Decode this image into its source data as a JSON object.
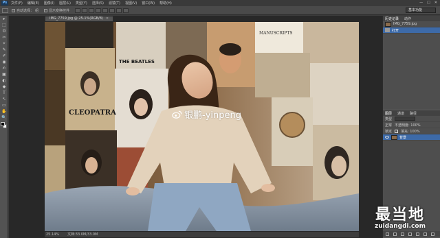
{
  "menubar": {
    "logo": "Ps",
    "items": [
      "文件(F)",
      "编辑(E)",
      "图像(I)",
      "图层(L)",
      "类型(Y)",
      "选择(S)",
      "滤镜(T)",
      "视图(V)",
      "窗口(W)",
      "帮助(H)"
    ],
    "window_controls": [
      "—",
      "□",
      "✕"
    ]
  },
  "optionsbar": {
    "auto_select_label": "自动选择：",
    "auto_select_value": "组",
    "show_transform_label": "显示变换控件",
    "workspace": "基本功能"
  },
  "toolbox": {
    "tools": [
      "▸",
      "⬚",
      "ʘ",
      "✂",
      "⌖",
      "✎",
      "✐",
      "◉",
      "✍",
      "▣",
      "◐",
      "◆",
      "T",
      "↖",
      "▭",
      "✋",
      "🔍"
    ]
  },
  "document": {
    "tab_title": "IMG_7759.jpg @ 25.1%(RGB/8)",
    "tab_close": "×",
    "status_zoom": "25.14%",
    "status_doc": "文档:33.0M/33.0M"
  },
  "photo": {
    "watermark_text": "银鹏-yinpeng",
    "poster_cleopatra": "CLEOPATRA",
    "poster_beatles": "THE BEATLES",
    "poster_manuscripts": "MANUSCRIPTS"
  },
  "panels": {
    "history_tabs": [
      "历史记录",
      "动作"
    ],
    "history_rows": [
      {
        "label": "IMG_7759.jpg",
        "selected": false
      },
      {
        "label": "打开",
        "selected": true
      }
    ],
    "layer_tabs": [
      "图层",
      "通道",
      "路径"
    ],
    "layer_controls": [
      "类型",
      "正常",
      "不透明度: 100%",
      "锁定",
      "填充: 100%"
    ],
    "layer_name": "背景"
  },
  "brand": {
    "cn": "最当地",
    "url": "zuidangdi.com"
  },
  "colors": {
    "ui_dark": "#3c3c3c",
    "panel": "#535353",
    "selection": "#3d6aa8",
    "foreground": "#000000",
    "background": "#ffffff"
  }
}
